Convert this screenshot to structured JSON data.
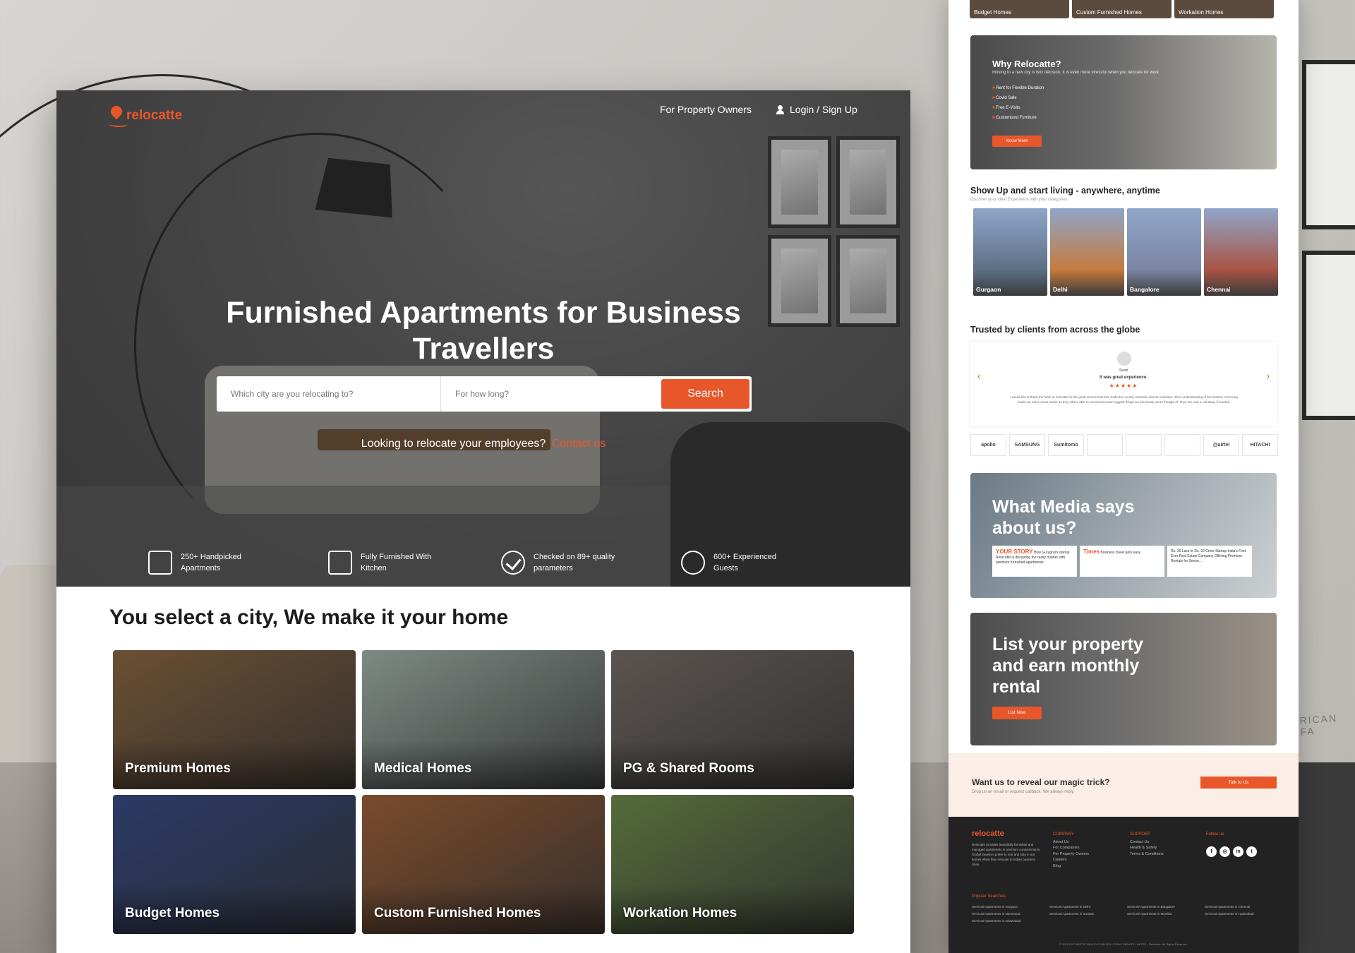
{
  "main": {
    "logo_text": "relocatte",
    "nav": {
      "owners": "For Property Owners",
      "login": "Login / Sign Up"
    },
    "hero_title": "Furnished Apartments for Business Travellers",
    "search": {
      "city_placeholder": "Which city are you relocating to?",
      "duration_placeholder": "For how long?",
      "button": "Search"
    },
    "relocate_text": "Looking to relocate your employees?",
    "contact_link": "Contact us",
    "features": [
      {
        "line1": "250+ Handpicked",
        "line2": "Apartments"
      },
      {
        "line1": "Fully Furnished With",
        "line2": "Kitchen"
      },
      {
        "line1": "Checked on 89+ quality",
        "line2": "parameters"
      },
      {
        "line1": "600+ Experienced",
        "line2": "Guests"
      }
    ],
    "section_title": "You select a city, We make it your home",
    "cards": [
      {
        "label": "Premium Homes",
        "color": "#6b4f33"
      },
      {
        "label": "Medical Homes",
        "color": "#7d8a84"
      },
      {
        "label": "PG & Shared Rooms",
        "color": "#5b5450"
      },
      {
        "label": "Budget Homes",
        "color": "#2b3a66"
      },
      {
        "label": "Custom Furnished Homes",
        "color": "#7a4b2c"
      },
      {
        "label": "Workation Homes",
        "color": "#556b3b"
      }
    ]
  },
  "side": {
    "top_cards": [
      "Budget Homes",
      "Custom Furnished Homes",
      "Workation Homes"
    ],
    "why": {
      "title": "Why Relocatte?",
      "desc": "Moving to a new city is BIG decision. It is even more stressful when you relocate for work.",
      "items": [
        "Rent for Flexible Duration",
        "Covid Safe",
        "Free E-Visits",
        "Customized Furniture"
      ],
      "button": "Know More"
    },
    "showup_title": "Show Up and start living - anywhere, anytime",
    "showup_sub": "Discover your ideal Experience with your categories",
    "cities": [
      {
        "label": "Gurgaon",
        "color": "#5d6f86"
      },
      {
        "label": "Delhi",
        "color": "#c67a3e"
      },
      {
        "label": "Bangalore",
        "color": "#7b86a3"
      },
      {
        "label": "Chennai",
        "color": "#a95445"
      }
    ],
    "trusted_title": "Trusted by clients from across the globe",
    "testimonial": {
      "name": "Swati",
      "quote": "It was great experience.",
      "stars": "★★★★★",
      "body": "I would like to thank the team at relocatte for the great service that has made the country transition almost seamless. Their understanding of the hassles of moving made our move much easier as they where able to recommend and suggest things we previously never thought of. They are only a call away if needed."
    },
    "logos": [
      "apollo",
      "SAMSUNG",
      "Sumitomo",
      "",
      "",
      "",
      "@airtel",
      "HITACHI"
    ],
    "media_title": "What Media says about us?",
    "media_cards": [
      {
        "tag": "YOUR STORY",
        "text": "How Gurugram startup Relocatte is disrupting the realty market with premium furnished apartments"
      },
      {
        "tag": "Times",
        "text": "Business travel gets easy"
      },
      {
        "tag": "",
        "text": "Rs. 20 Lacs to Rs. 20 Crore Startup India's First Ever Real Estate Company Offering Premium Rentals for Senior..."
      }
    ],
    "list_title": "List your property and earn monthly rental",
    "list_button": "List Now",
    "magic_title": "Want us to reveal our magic trick?",
    "magic_sub": "Drop us an email or request callback. We always reply.",
    "magic_button": "Talk to Us",
    "footer": {
      "logo": "relocatte",
      "desc": "Relocatte provides beautifully furnished and managed apartments in premium condominiums. Global travelers prefer to rent and stay in our homes when they relocate to Indian business cities.",
      "company_title": "COMPANY",
      "company": [
        "About Us",
        "For Companies",
        "For Property Owners",
        "Careers",
        "Blog"
      ],
      "support_title": "SUPPORT",
      "support": [
        "Contact Us",
        "Health & Safety",
        "Terms & Conditions"
      ],
      "follow_title": "Follow us",
      "social": [
        "f",
        "◎",
        "in",
        "t"
      ],
      "popular_title": "Popular Searches",
      "popular": [
        "Serviced Apartments in Gurgaon",
        "Serviced Apartments in Delhi",
        "Serviced Apartments in Bangalore",
        "Serviced Apartments in Chennai",
        "Serviced Apartments in Neemrana",
        "Serviced Apartments in Sonipat",
        "Serviced Apartments in Mumbai",
        "Serviced Apartments in Hyderabad",
        "Serviced Apartments in Ghaziabad"
      ],
      "copyright": "© 2022 FUTURISTIC RELOCATION SOLUTIONS PRIVATE LIMITED - Relocatte. All Rights Reserved."
    }
  },
  "backdrop": {
    "ottoman_text": "RICAN FA"
  },
  "colors": {
    "accent": "#e8572a"
  }
}
